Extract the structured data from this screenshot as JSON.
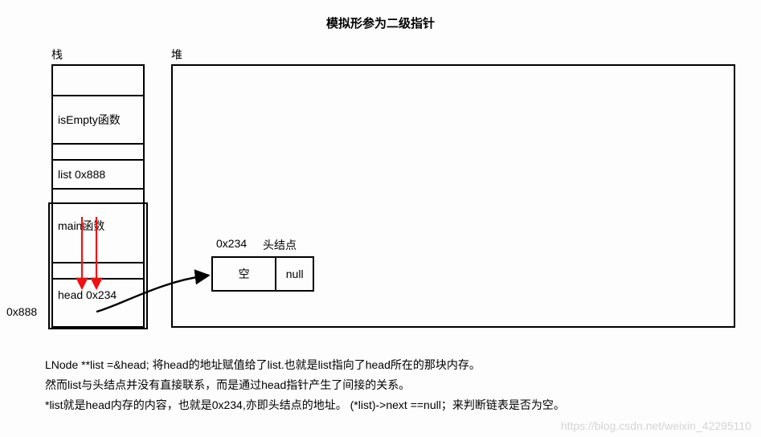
{
  "title": "模拟形参为二级指针",
  "labels": {
    "stack": "栈",
    "heap": "堆",
    "stack_addr": "0x888"
  },
  "stack": {
    "isEmpty": "isEmpty函数",
    "list": "list 0x888",
    "main": "main函数",
    "head": "head 0x234"
  },
  "node": {
    "addr": "0x234",
    "name": "头结点",
    "left": "空",
    "right": "null"
  },
  "explain": {
    "line1": "LNode **list =&head; 将head的地址赋值给了list.也就是list指向了head所在的那块内存。",
    "line2": "然而list与头结点并没有直接联系，而是通过head指针产生了间接的关系。",
    "line3": "*list就是head内存的内容，也就是0x234,亦即头结点的地址。   (*list)->next ==null；来判断链表是否为空。"
  },
  "watermark": "https://blog.csdn.net/weixin_42295110"
}
